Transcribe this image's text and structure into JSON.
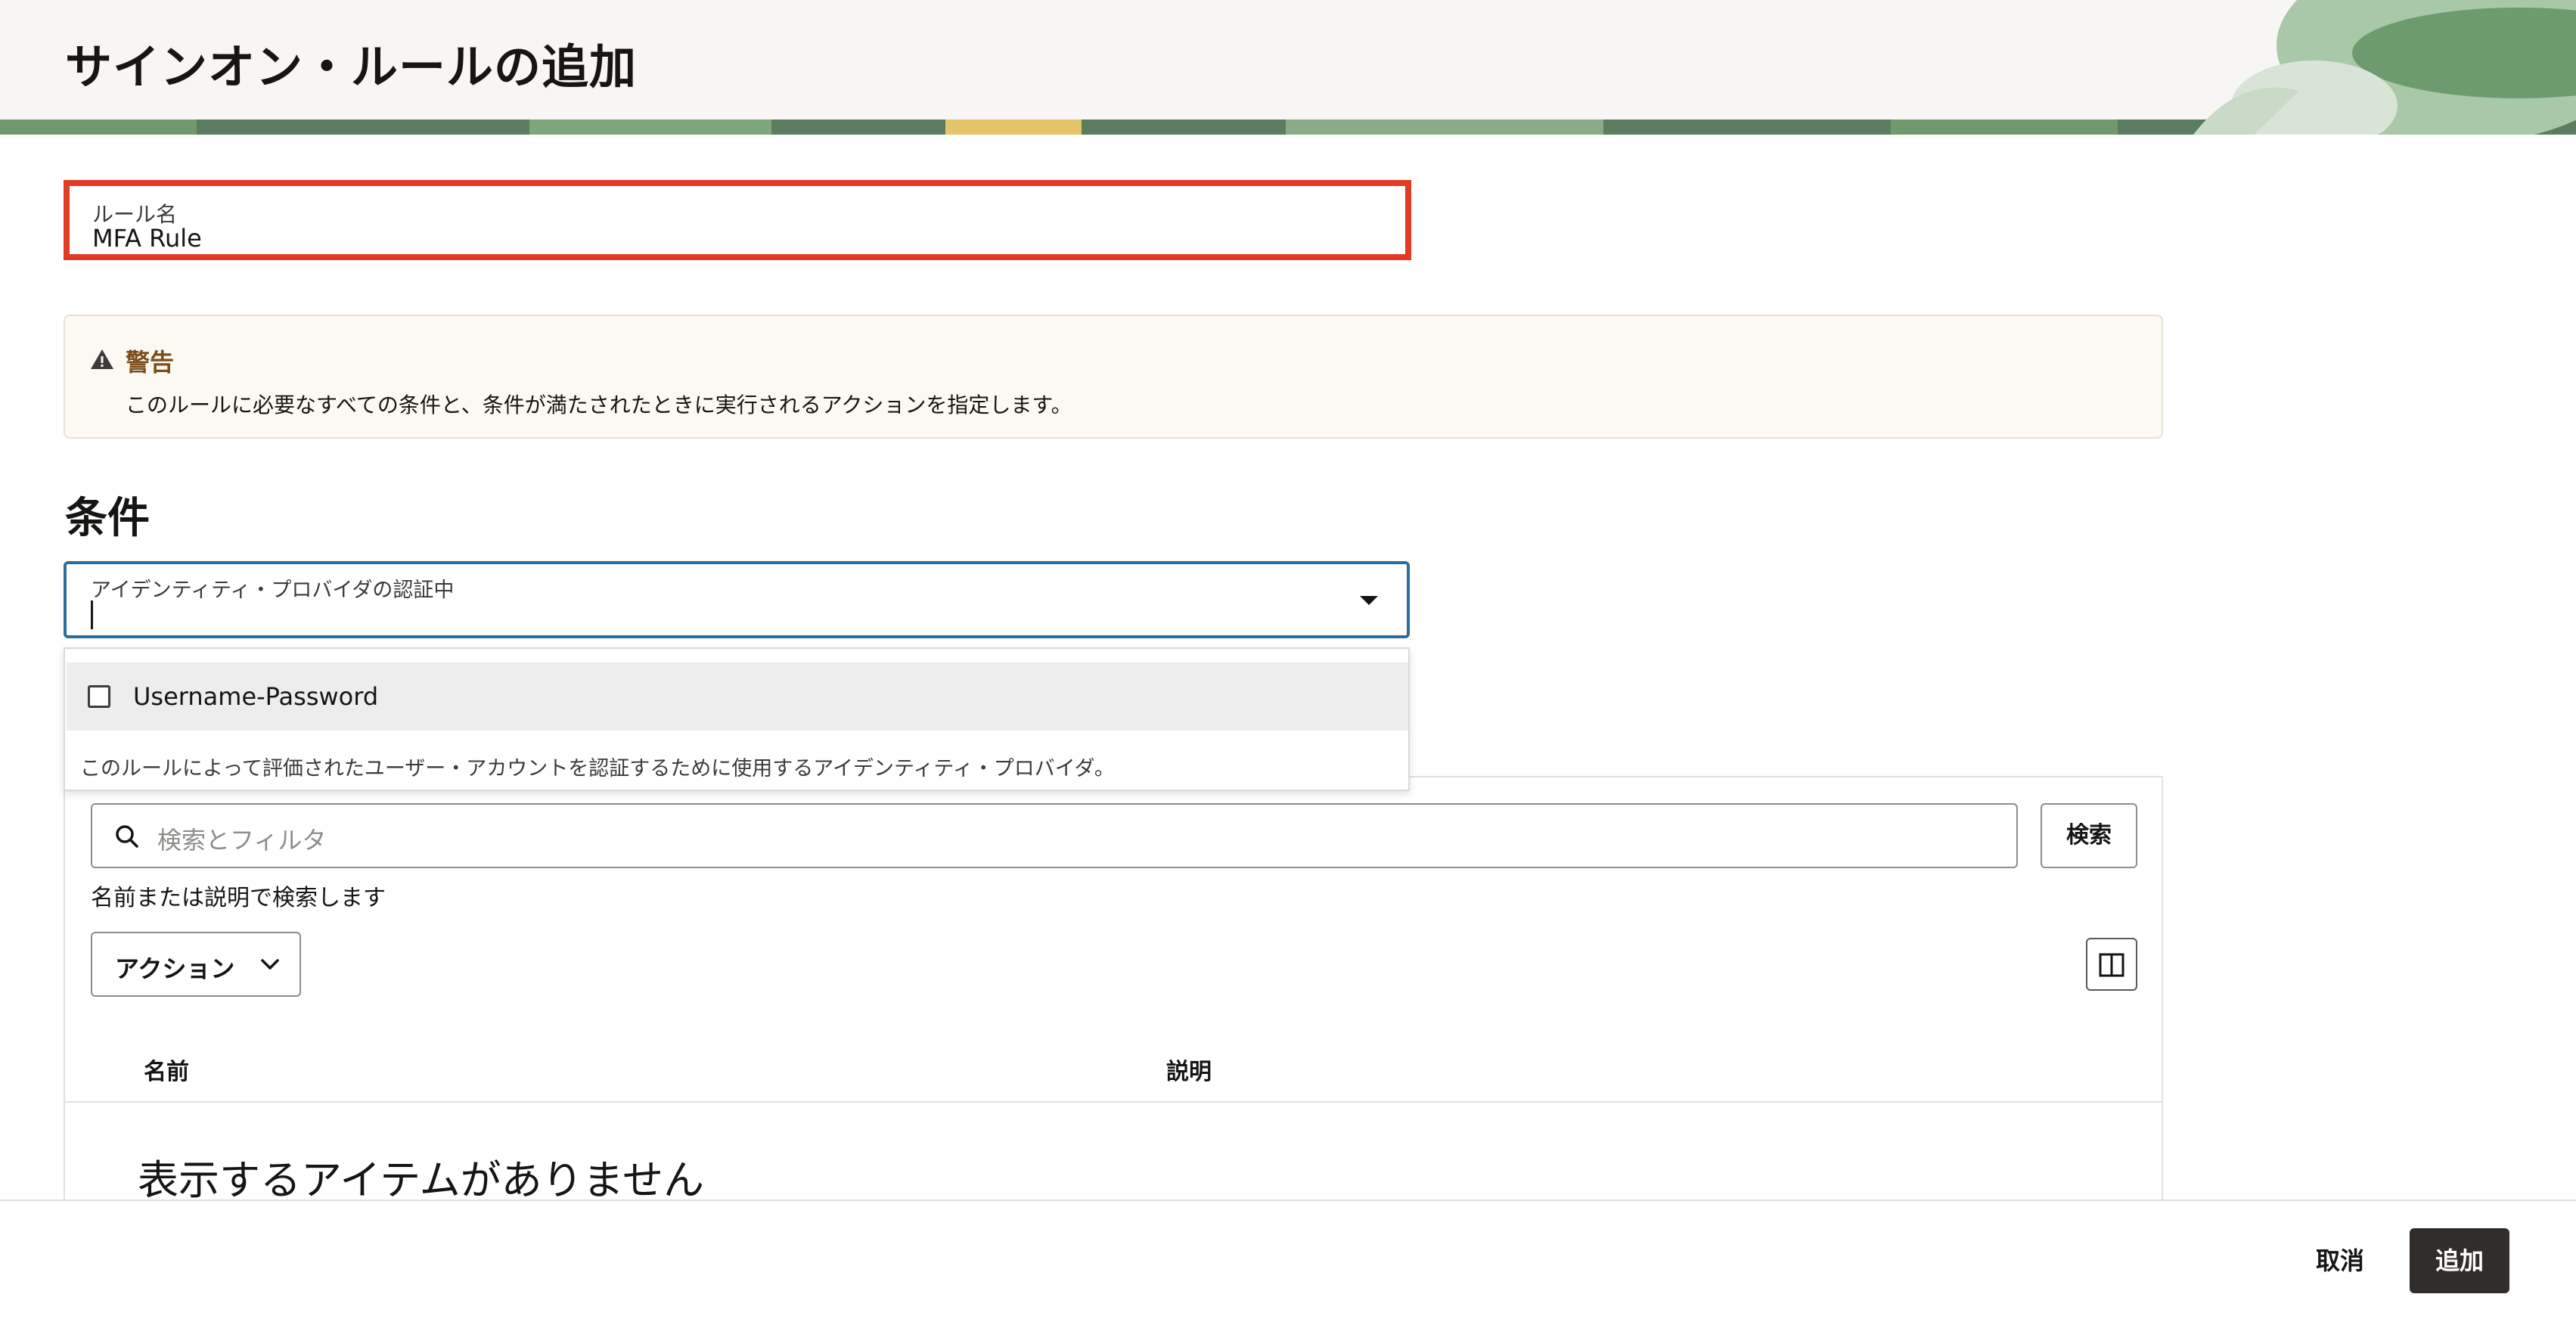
{
  "header": {
    "title": "サインオン・ルールの追加"
  },
  "rule_name": {
    "label": "ルール名",
    "value": "MFA Rule"
  },
  "warning": {
    "title": "警告",
    "text": "このルールに必要なすべての条件と、条件が満たされたときに実行されるアクションを指定します。"
  },
  "conditions": {
    "title": "条件",
    "idp_select": {
      "label": "アイデンティティ・プロバイダの認証中",
      "value": "",
      "options": [
        {
          "label": "Username-Password",
          "checked": false
        }
      ],
      "help": "このルールによって評価されたユーザー・アカウントを認証するために使用するアイデンティティ・プロバイダ。"
    }
  },
  "provider_table": {
    "search_placeholder": "検索とフィルタ",
    "search_button": "検索",
    "search_help": "名前または説明で検索します",
    "actions_label": "アクション",
    "columns": [
      "名前",
      "説明"
    ],
    "empty_message": "表示するアイテムがありません"
  },
  "footer": {
    "cancel_label": "取消",
    "add_label": "追加"
  },
  "colors": {
    "error_border": "#e13b24",
    "focus_border": "#2c6ca0",
    "primary_button": "#312d2a",
    "warning_title": "#7a4e1a"
  }
}
